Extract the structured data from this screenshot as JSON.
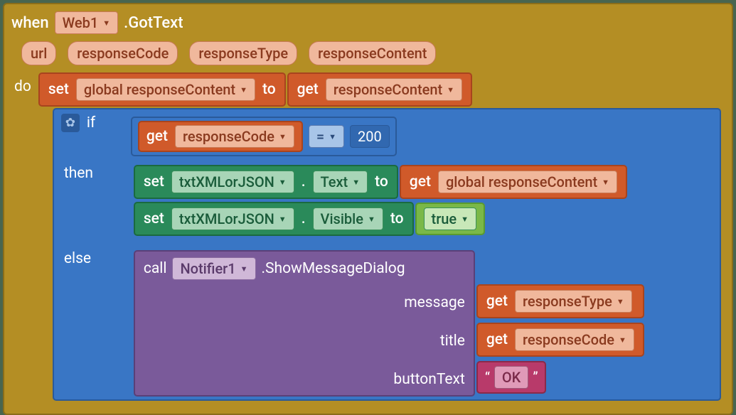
{
  "event": {
    "when": "when",
    "component": "Web1",
    "eventName": ".GotText",
    "params": [
      "url",
      "responseCode",
      "responseType",
      "responseContent"
    ],
    "do": "do"
  },
  "set1": {
    "set": "set",
    "var": "global responseContent",
    "to": "to",
    "get": "get",
    "getVar": "responseContent"
  },
  "ifblock": {
    "if": "if",
    "then": "then",
    "else": "else",
    "getLabel": "get",
    "condVar": "responseCode",
    "op": "=",
    "val": "200"
  },
  "then1": {
    "set": "set",
    "comp": "txtXMLorJSON",
    "prop": "Text",
    "to": "to",
    "get": "get",
    "getVar": "global responseContent"
  },
  "then2": {
    "set": "set",
    "comp": "txtXMLorJSON",
    "prop": "Visible",
    "to": "to",
    "val": "true"
  },
  "elseCall": {
    "call": "call",
    "comp": "Notifier1",
    "method": ".ShowMessageDialog",
    "args": {
      "message": {
        "label": "message",
        "get": "get",
        "var": "responseType"
      },
      "title": {
        "label": "title",
        "get": "get",
        "var": "responseCode"
      },
      "buttonText": {
        "label": "buttonText",
        "q1": "“",
        "val": "OK",
        "q2": "”"
      }
    }
  }
}
